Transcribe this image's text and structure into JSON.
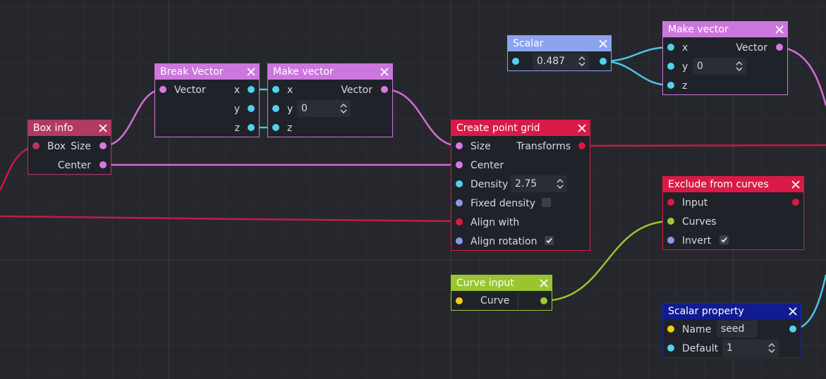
{
  "colors": {
    "vector_wire": "#d46ed8",
    "scalar_wire": "#4cc4e4",
    "transform_wire": "#c61a44",
    "curve_wire": "#9ac530",
    "port_vector": "#d879e0",
    "port_scalar": "#4fd2ee",
    "port_bool": "#8c98ea",
    "port_transform": "#e0173f",
    "port_box": "#b8365e",
    "port_curve": "#a0c836",
    "port_string": "#f0d010"
  },
  "nodes": {
    "box_info": {
      "title": "Box info",
      "in_box": "Box",
      "out_size": "Size",
      "out_center": "Center"
    },
    "break_vector": {
      "title": "Break Vector",
      "in_vector": "Vector",
      "out_x": "x",
      "out_y": "y",
      "out_z": "z"
    },
    "make_vector_1": {
      "title": "Make vector",
      "in_x": "x",
      "in_y": "y",
      "y_value": "0",
      "in_z": "z",
      "out_vector": "Vector"
    },
    "scalar": {
      "title": "Scalar",
      "value": "0.487"
    },
    "make_vector_2": {
      "title": "Make vector",
      "in_x": "x",
      "in_y": "y",
      "y_value": "0",
      "in_z": "z",
      "out_vector": "Vector"
    },
    "create_point_grid": {
      "title": "Create point grid",
      "in_size": "Size",
      "out_transforms": "Transforms",
      "in_center": "Center",
      "in_density": "Density",
      "density_value": "2.75",
      "in_fixed_density": "Fixed density",
      "fixed_density_checked": false,
      "in_align_with": "Align with",
      "in_align_rotation": "Align rotation",
      "align_rotation_checked": true
    },
    "exclude_from_curves": {
      "title": "Exclude from curves",
      "in_input": "Input",
      "in_curves": "Curves",
      "in_invert": "Invert",
      "invert_checked": true
    },
    "curve_input": {
      "title": "Curve input",
      "field_label": "Curve"
    },
    "scalar_property": {
      "title": "Scalar property",
      "in_name": "Name",
      "name_value": "seed",
      "in_default": "Default",
      "default_value": "1"
    }
  }
}
